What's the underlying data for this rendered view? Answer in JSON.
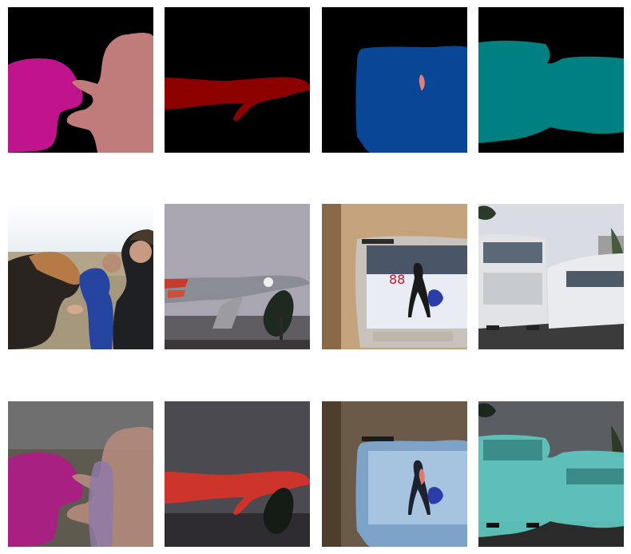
{
  "grid": {
    "rows": [
      "segmentation-masks",
      "original-images",
      "mask-overlays"
    ],
    "columns": [
      "horses-and-people",
      "airplane-on-pedestal",
      "television-figure-skating",
      "buses"
    ],
    "colors": {
      "mask_background": "#000000",
      "horse_mask": "#c0148c",
      "person_mask": "#c07b7b",
      "airplane_mask": "#8c0000",
      "tv_mask": "#0a4696",
      "tv_inner_mask": "#e0807a",
      "bus_mask": "#008080"
    }
  }
}
